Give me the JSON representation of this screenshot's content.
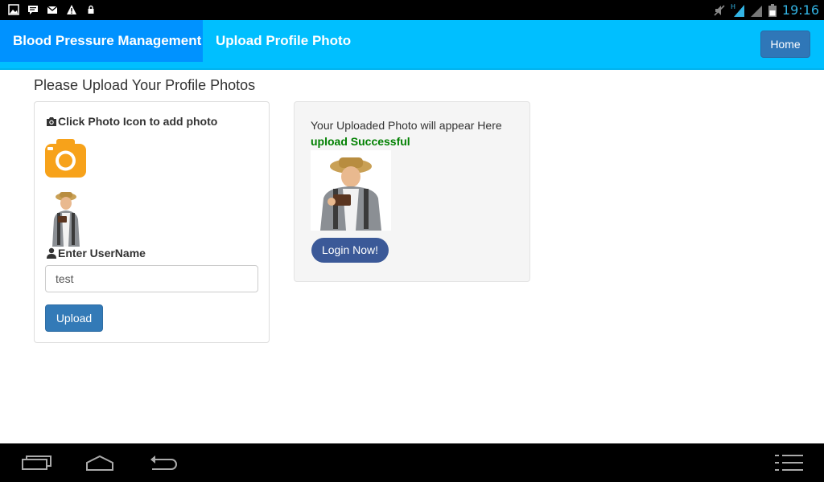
{
  "status_bar": {
    "time": "19:16",
    "left_icons": [
      "gallery-icon",
      "chat-icon",
      "gmail-icon",
      "warning-icon",
      "lock-icon"
    ],
    "right_icons": [
      "no-sound-icon",
      "signal-h-icon",
      "signal-icon",
      "battery-icon"
    ]
  },
  "navbar": {
    "brand": "Blood Pressure Management",
    "active_link": "Upload Profile Photo",
    "home_button": "Home",
    "colors": {
      "bar": "#00bfff",
      "brand": "#0092ff",
      "home": "#2f77b8"
    }
  },
  "page": {
    "heading": "Please Upload Your Profile Photos"
  },
  "upload_panel": {
    "camera_label": "Click Photo Icon to add photo",
    "camera_icon": "camera-icon",
    "username_label": "Enter UserName",
    "username_value": "test",
    "upload_button": "Upload"
  },
  "result_panel": {
    "note": "Your Uploaded Photo will appear Here",
    "status": "upload Successful",
    "login_button": "Login Now!",
    "colors": {
      "status": "#008000",
      "login": "#3b5998"
    }
  },
  "system_nav": {
    "buttons": [
      "recent-apps-icon",
      "home-icon",
      "back-icon",
      "menu-icon"
    ]
  }
}
